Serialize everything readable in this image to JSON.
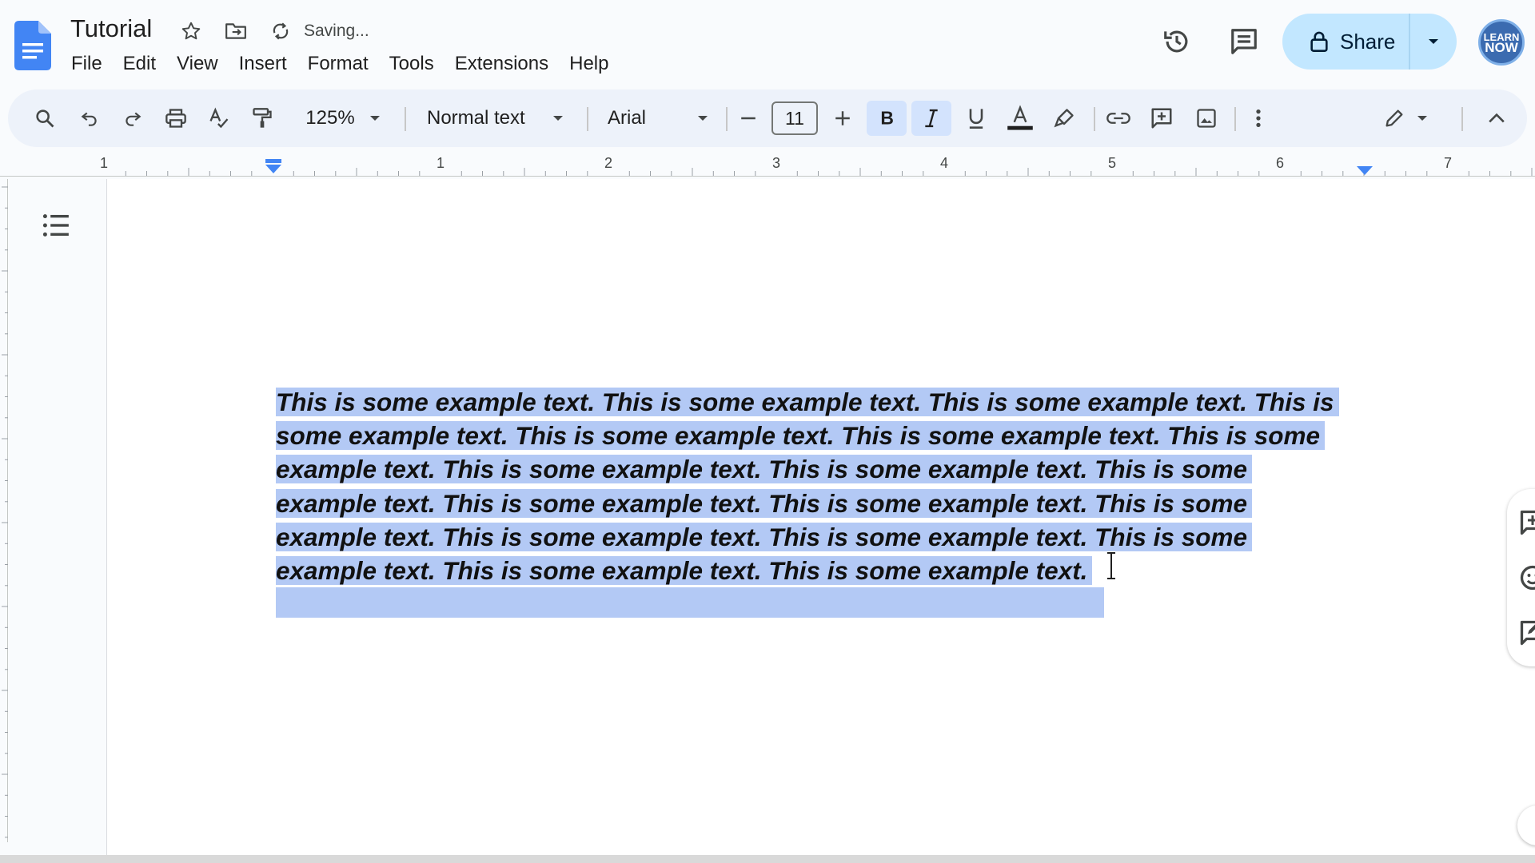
{
  "app": {
    "title": "Tutorial",
    "status": "Saving..."
  },
  "menu": [
    "File",
    "Edit",
    "View",
    "Insert",
    "Format",
    "Tools",
    "Extensions",
    "Help"
  ],
  "header_actions": {
    "share_label": "Share",
    "avatar_text_line1": "LEARN",
    "avatar_text_line2": "NOW"
  },
  "toolbar": {
    "zoom": "125%",
    "style": "Normal text",
    "font": "Arial",
    "font_size": "11",
    "bold_active": true,
    "italic_active": true
  },
  "ruler": {
    "labels": [
      "1",
      "1",
      "2",
      "3",
      "4",
      "5",
      "6",
      "7"
    ]
  },
  "document": {
    "lines": [
      "This is some example text. This is some example text. This is some example text. This is",
      "some example text. This is some example text. This is some example text. This is some",
      "example text. This is some example text. This is some example text. This is some",
      "example text. This is some example text. This is some example text. This is some",
      "example text. This is some example text. This is some example text. This is some",
      "example text. This is some example text. This is some example text."
    ]
  },
  "colors": {
    "selection": "#b3c9f5",
    "share_bg": "#c2e7ff",
    "toolbar_bg": "#edf2fa",
    "docs_blue": "#4285f4"
  }
}
